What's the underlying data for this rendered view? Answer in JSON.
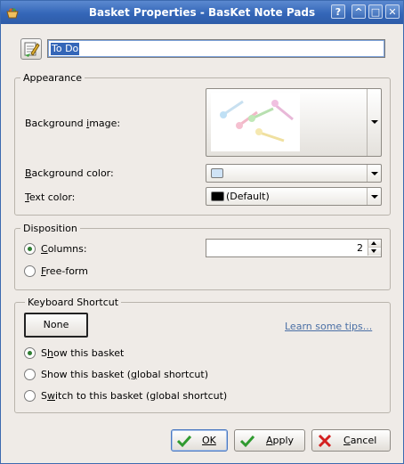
{
  "window": {
    "title": "Basket Properties - BasKet Note Pads",
    "title_buttons": {
      "help": "?",
      "minimize": "^",
      "maximize": "□",
      "close": "✕"
    }
  },
  "basket_name": "To Do",
  "appearance": {
    "group_title": "Appearance",
    "background_image": {
      "label": "Background image:",
      "icon": "pushpins-image"
    },
    "background_color": {
      "label": "Background color:",
      "swatch_color": "#cfe3f6"
    },
    "text_color": {
      "label": "Text color:",
      "value": "(Default)",
      "swatch_color": "#000000"
    }
  },
  "disposition": {
    "group_title": "Disposition",
    "columns_label": "Columns:",
    "columns_value": "2",
    "freeform_label": "Free-form",
    "selected": "columns"
  },
  "keyboard_shortcut": {
    "group_title": "Keyboard Shortcut",
    "shortcut_button": "None",
    "learn_link": "Learn some tips...",
    "options": [
      "Show this basket",
      "Show this basket (global shortcut)",
      "Switch to this basket (global shortcut)"
    ],
    "selected_index": 0
  },
  "buttons": {
    "ok": "OK",
    "apply": "Apply",
    "cancel": "Cancel"
  },
  "colors": {
    "titlebar": "#3466b8",
    "accent_green": "#2f7d32",
    "cancel_red": "#d42020",
    "link": "#4a6fa5"
  }
}
